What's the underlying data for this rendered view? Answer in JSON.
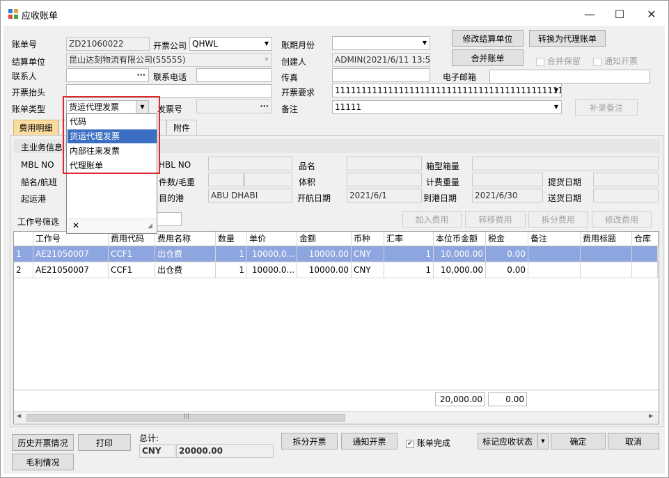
{
  "window": {
    "title": "应收账单",
    "min_glyph": "—",
    "max_glyph": "☐",
    "close_glyph": "✕"
  },
  "form": {
    "bill_no_label": "账单号",
    "bill_no": "ZD21060022",
    "invoice_company_label": "开票公司",
    "invoice_company": "QHWL",
    "period_label": "账期月份",
    "period": "",
    "settle_unit_label": "结算单位",
    "settle_unit": "昆山达刻物流有限公司(55555)",
    "creator_label": "创建人",
    "creator": "ADMIN(2021/6/11 13:55",
    "contact_label": "联系人",
    "contact": "",
    "contact_btn": "···",
    "phone_label": "联系电话",
    "phone": "",
    "fax_label": "传真",
    "fax": "",
    "email_label": "电子邮箱",
    "email": "",
    "invoice_title_label": "开票抬头",
    "invoice_title": "",
    "invoice_req_label": "开票要求",
    "invoice_req": "111111111111111111111111111111111111111111111...",
    "bill_type_label": "账单类型",
    "bill_type": "货运代理发票",
    "invoice_no_label": "发票号",
    "invoice_no": "",
    "invoice_no_btn": "···",
    "remark_label": "备注",
    "remark": "11111"
  },
  "buttons": {
    "modify_settle": "修改结算单位",
    "convert_agent": "转换为代理账单",
    "merge": "合并账单",
    "merge_keep": "合并保留",
    "notify_invoice": "通知开票",
    "add_remark": "补录备注"
  },
  "tabs": [
    "费用明细",
    "",
    "附件"
  ],
  "main_info": {
    "title": "主业务信息",
    "mbl_label": "MBL NO",
    "hbl_label": "HBL NO",
    "product_label": "品名",
    "container_label": "箱型箱量",
    "vessel_label": "船名/航班",
    "pkg_label": "件数/毛重",
    "volume_label": "体积",
    "charge_wt_label": "计费重量",
    "pickup_label": "提货日期",
    "pol_label": "起运港",
    "pod_label": "目的港",
    "pod": "ABU DHABI",
    "etd_label": "开航日期",
    "etd": "2021/6/1",
    "eta_label": "到港日期",
    "eta": "2021/6/30",
    "delivery_label": "送货日期"
  },
  "filter": {
    "label": "工作号筛选",
    "value": ""
  },
  "fee_buttons": {
    "add": "加入费用",
    "transfer": "转移费用",
    "split": "拆分费用",
    "modify": "修改费用"
  },
  "grid": {
    "headers": [
      "",
      "工作号",
      "费用代码",
      "费用名称",
      "数量",
      "单价",
      "金额",
      "币种",
      "汇率",
      "本位币金额",
      "税金",
      "备注",
      "费用标题",
      "仓库"
    ],
    "rows": [
      {
        "idx": "1",
        "job": "AE21050007",
        "code": "CCF1",
        "name": "出仓费",
        "qty": "1",
        "price": "10000.0...",
        "amount": "10000.00",
        "cur": "CNY",
        "rate": "1",
        "local": "10,000.00",
        "tax": "0.00"
      },
      {
        "idx": "2",
        "job": "AE21050007",
        "code": "CCF1",
        "name": "出仓费",
        "qty": "1",
        "price": "10000.0...",
        "amount": "10000.00",
        "cur": "CNY",
        "rate": "1",
        "local": "10,000.00",
        "tax": "0.00"
      }
    ],
    "sum_local": "20,000.00",
    "sum_tax": "0.00"
  },
  "dropdown": {
    "items": [
      "代码",
      "货运代理发票",
      "内部往来发票",
      "代理账单"
    ],
    "selected_index": 1,
    "close_glyph": "✕"
  },
  "bottom": {
    "history": "历史开票情况",
    "print": "打印",
    "gross": "毛利情况",
    "total_label": "总计:",
    "total_cur": "CNY",
    "total_value": "20000.00",
    "split_invoice": "拆分开票",
    "notify_invoice": "通知开票",
    "bill_done": "账单完成",
    "bill_done_checked": true,
    "mark_receivable": "标记应收状态",
    "confirm": "确定",
    "cancel": "取消"
  },
  "colors": {
    "accent_tab": "#fcdca0",
    "selected_row": "#8ea6df",
    "highlight_box": "#e0282c"
  }
}
